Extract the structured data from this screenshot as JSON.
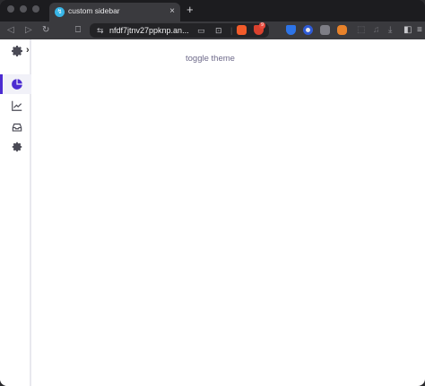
{
  "browser": {
    "tab": {
      "title": "custom sidebar",
      "favicon": "vite-icon"
    },
    "new_tab_label": "+",
    "tab_close_label": "×",
    "address": {
      "prefix_icon": "site-settings-icon",
      "url": "nfdf7jtnv27ppknp.an..."
    }
  },
  "page": {
    "toggle_label": "toggle theme",
    "sidebar": {
      "expand_label": "›",
      "items": [
        {
          "name": "analytics",
          "icon": "pie-chart-icon",
          "active": true
        },
        {
          "name": "trends",
          "icon": "chart-line-icon",
          "active": false
        },
        {
          "name": "inbox",
          "icon": "inbox-icon",
          "active": false
        },
        {
          "name": "settings",
          "icon": "gear-icon",
          "active": false
        }
      ]
    }
  },
  "colors": {
    "accent": "#4b2bd1",
    "icon": "#4a4a55",
    "toggle_text": "#6e6a8a"
  }
}
